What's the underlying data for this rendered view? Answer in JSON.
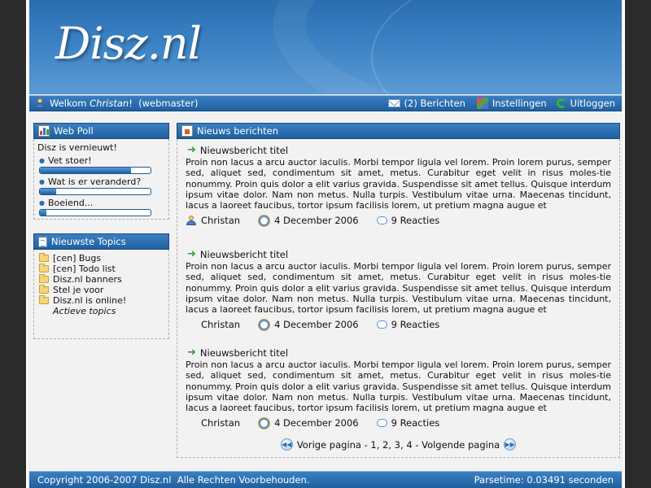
{
  "site": {
    "logo": "Disz.nl"
  },
  "topbar": {
    "welcome_prefix": "Welkom",
    "user_name": "Christan",
    "welcome_suffix": "!",
    "role": "(webmaster)",
    "messages": "(2) Berichten",
    "settings": "Instellingen",
    "logout": "Uitloggen"
  },
  "poll": {
    "title": "Web Poll",
    "question": "Disz is vernieuwt!",
    "options": [
      {
        "label": "Vet stoer!",
        "fraction": 0.82
      },
      {
        "label": "Wat is er veranderd?",
        "fraction": 0.15
      },
      {
        "label": "Boeiend...",
        "fraction": 0.06
      }
    ]
  },
  "topics": {
    "title": "Nieuwste Topics",
    "items": [
      "[cen] Bugs",
      "[cen] Todo list",
      "Disz.nl banners",
      "Stel je voor",
      "Disz.nl is online!"
    ],
    "more": "Actieve topics"
  },
  "news": {
    "title": "Nieuws berichten",
    "items": [
      {
        "title": "Nieuwsbericht titel",
        "body": "Proin non lacus a arcu auctor iaculis. Morbi tempor ligula vel lorem. Proin lorem purus, semper sed, aliquet sed, condimentum sit amet, metus. Curabitur eget velit in risus moles-tie nonummy. Proin quis dolor a elit varius gravida. Suspendisse sit amet tellus. Quisque interdum ipsum vitae dolor. Nam non metus. Nulla turpis. Vestibulum vitae urna. Maecenas tincidunt, lacus a laoreet faucibus, tortor ipsum facilisis lorem, ut pretium magna augue et",
        "author": "Christan",
        "date": "4 December 2006",
        "reactions": "9 Reacties"
      },
      {
        "title": "Nieuwsbericht titel",
        "body": "Proin non lacus a arcu auctor iaculis. Morbi tempor ligula vel lorem. Proin lorem purus, semper sed, aliquet sed, condimentum sit amet, metus. Curabitur eget velit in risus moles-tie nonummy. Proin quis dolor a elit varius gravida. Suspendisse sit amet tellus. Quisque interdum ipsum vitae dolor. Nam non metus. Nulla turpis. Vestibulum vitae urna. Maecenas tincidunt, lacus a laoreet faucibus, tortor ipsum facilisis lorem, ut pretium magna augue et",
        "author": "Christan",
        "date": "4 December 2006",
        "reactions": "9 Reacties"
      },
      {
        "title": "Nieuwsbericht titel",
        "body": "Proin non lacus a arcu auctor iaculis. Morbi tempor ligula vel lorem. Proin lorem purus, semper sed, aliquet sed, condimentum sit amet, metus. Curabitur eget velit in risus moles-tie nonummy. Proin quis dolor a elit varius gravida. Suspendisse sit amet tellus. Quisque interdum ipsum vitae dolor. Nam non metus. Nulla turpis. Vestibulum vitae urna. Maecenas tincidunt, lacus a laoreet faucibus, tortor ipsum facilisis lorem, ut pretium magna augue et",
        "author": "Christan",
        "date": "4 December 2006",
        "reactions": "9 Reacties"
      }
    ],
    "pager": "Vorige pagina - 1, 2, 3, 4 - Volgende pagina"
  },
  "footer": {
    "copyright": "Copyright 2006-2007 Disz.nl  Alle Rechten Voorbehouden.",
    "parsetime": "Parsetime: 0.03491 seconden"
  },
  "colors": {
    "accent": "#1f5f9f",
    "header": "#3b82c4",
    "page_bg": "#f2f2f2",
    "outer_bg": "#2b2b2b"
  }
}
